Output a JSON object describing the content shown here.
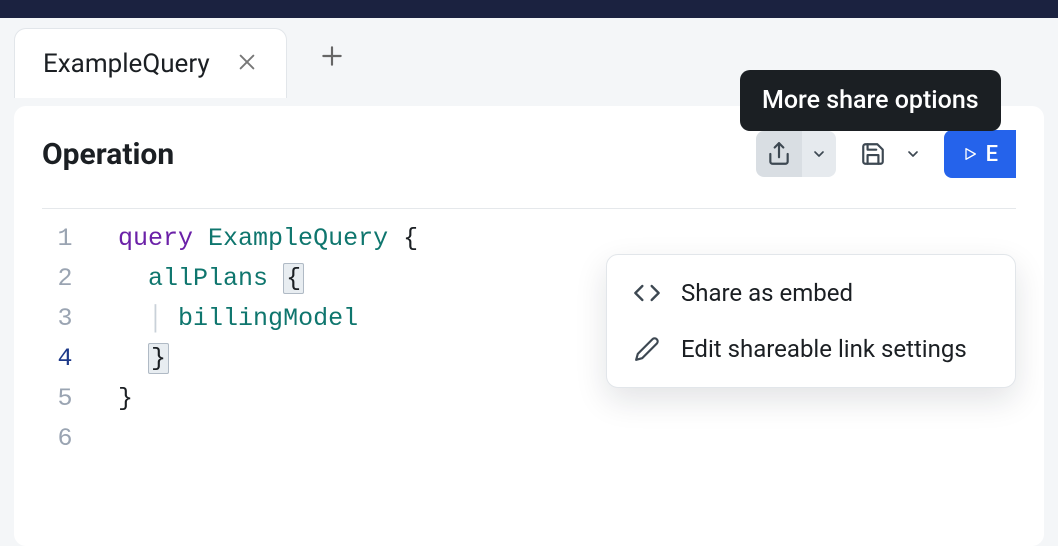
{
  "tabs": {
    "active": {
      "title": "ExampleQuery"
    }
  },
  "panel": {
    "title": "Operation"
  },
  "toolbar": {
    "run_label": "E"
  },
  "tooltip": {
    "text": "More share options"
  },
  "dropdown": {
    "items": [
      {
        "label": "Share as embed"
      },
      {
        "label": "Edit shareable link settings"
      }
    ]
  },
  "editor": {
    "lines": [
      "1",
      "2",
      "3",
      "4",
      "5",
      "6"
    ],
    "active_line": "4",
    "tokens": {
      "l1_kw": "query",
      "l1_name": "ExampleQuery",
      "l1_brace": "{",
      "l2_field": "allPlans",
      "l2_brace": "{",
      "l3_field": "billingModel",
      "l4_brace": "}",
      "l5_brace": "}"
    }
  }
}
